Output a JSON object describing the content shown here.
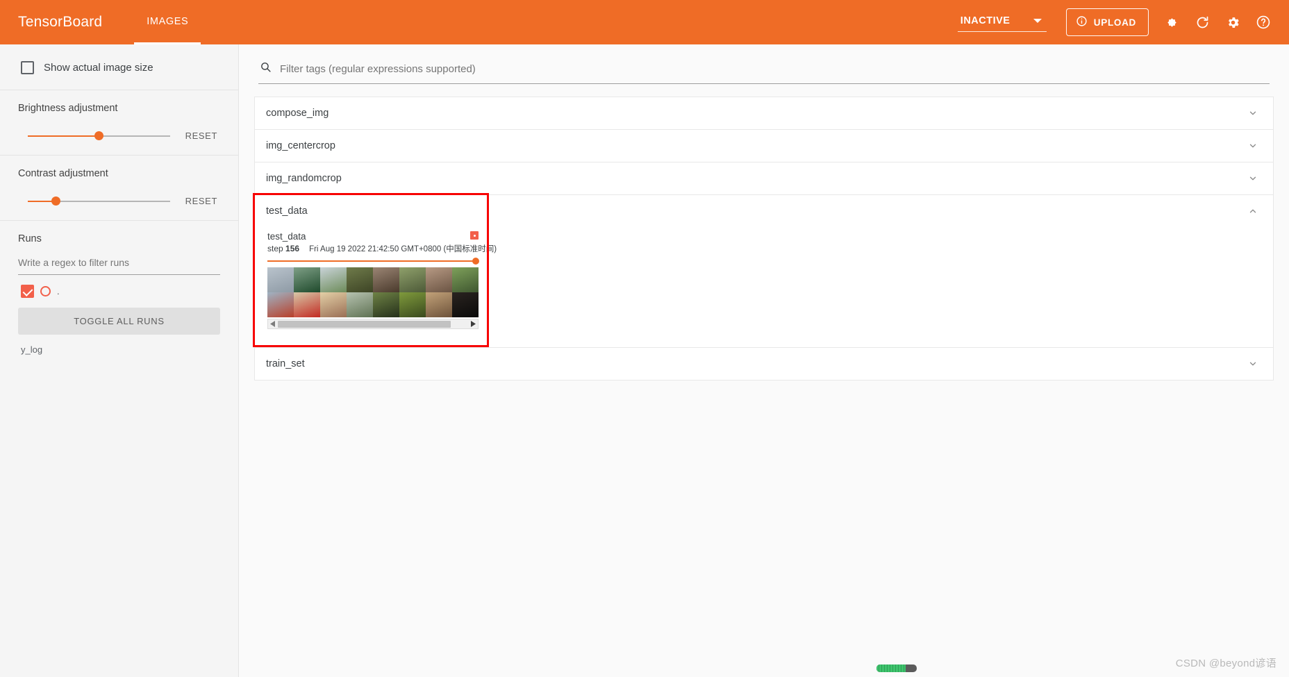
{
  "header": {
    "brand": "TensorBoard",
    "tabs": [
      {
        "label": "IMAGES",
        "active": true
      }
    ],
    "run_selector": {
      "value": "INACTIVE",
      "caret_icon": "caret-down-icon"
    },
    "upload_label": "UPLOAD",
    "upload_icon": "info-circle-icon",
    "icons": [
      {
        "name": "brightness-contrast-icon",
        "title": "Toggle dark mode"
      },
      {
        "name": "refresh-icon",
        "title": "Refresh"
      },
      {
        "name": "settings-gear-icon",
        "title": "Settings"
      },
      {
        "name": "help-circle-icon",
        "title": "Help"
      }
    ],
    "accent_color": "#ef6c26"
  },
  "sidebar": {
    "show_actual_size": {
      "label": "Show actual image size",
      "checked": false
    },
    "brightness": {
      "label": "Brightness adjustment",
      "reset_label": "RESET",
      "value_pct": 50
    },
    "contrast": {
      "label": "Contrast adjustment",
      "reset_label": "RESET",
      "value_pct": 20
    },
    "runs": {
      "heading": "Runs",
      "filter_placeholder": "Write a regex to filter runs",
      "filter_value": "",
      "items": [
        {
          "name": ".",
          "checked": true,
          "color": "#f2604a"
        }
      ],
      "toggle_all_label": "TOGGLE ALL RUNS",
      "footer_text": "y_log"
    }
  },
  "main": {
    "search": {
      "placeholder": "Filter tags (regular expressions supported)",
      "value": "",
      "icon": "search-icon"
    },
    "tags": [
      {
        "name": "compose_img",
        "expanded": false,
        "chevron": "chevron-down-icon"
      },
      {
        "name": "img_centercrop",
        "expanded": false,
        "chevron": "chevron-down-icon"
      },
      {
        "name": "img_randomcrop",
        "expanded": false,
        "chevron": "chevron-down-icon"
      },
      {
        "name": "test_data",
        "expanded": true,
        "chevron": "chevron-up-icon"
      },
      {
        "name": "train_set",
        "expanded": false,
        "chevron": "chevron-down-icon"
      }
    ],
    "image_card": {
      "title": "test_data",
      "step_label": "step",
      "step_value": "156",
      "timestamp": "Fri Aug 19 2022 21:42:50 GMT+0800 (中国标准时间)",
      "badge_icon": "run-color-swatch-icon",
      "slider_position_pct": 100,
      "grid": {
        "rows": 2,
        "cols": 8,
        "cells": [
          {
            "alt": "airplane",
            "c1": "#b9c3cc",
            "c2": "#8e9aa5"
          },
          {
            "alt": "automobile-green",
            "c1": "#7e9f86",
            "c2": "#1f4a2c"
          },
          {
            "alt": "airplane-runway",
            "c1": "#c9d3d8",
            "c2": "#6d8c5a"
          },
          {
            "alt": "bird-branch",
            "c1": "#6f7b4a",
            "c2": "#3d4425"
          },
          {
            "alt": "cat-ground",
            "c1": "#9b8574",
            "c2": "#4a3a2c"
          },
          {
            "alt": "deer-grass",
            "c1": "#8fa06b",
            "c2": "#4d5a38"
          },
          {
            "alt": "dog-person",
            "c1": "#b79a84",
            "c2": "#6b5443"
          },
          {
            "alt": "deer-forest",
            "c1": "#7ea05a",
            "c2": "#3f5730"
          },
          {
            "alt": "truck-road",
            "c1": "#9fb3c4",
            "c2": "#b8402a"
          },
          {
            "alt": "automobile-red",
            "c1": "#d8c8a8",
            "c2": "#c22a22"
          },
          {
            "alt": "bird-wood",
            "c1": "#e3cfa6",
            "c2": "#9a6f55"
          },
          {
            "alt": "automobile-white",
            "c1": "#b6c2b0",
            "c2": "#5f7253"
          },
          {
            "alt": "cat-dark",
            "c1": "#6e8245",
            "c2": "#25301a"
          },
          {
            "alt": "deer-field",
            "c1": "#7f9a3c",
            "c2": "#3a4a1e"
          },
          {
            "alt": "deer-brown",
            "c1": "#c2a279",
            "c2": "#6d523a"
          },
          {
            "alt": "dog-black",
            "c1": "#2a2420",
            "c2": "#0a0a0a"
          }
        ]
      },
      "scrollbar": {
        "left_arrow_icon": "arrow-left-icon",
        "right_arrow_icon": "arrow-right-icon",
        "thumb_width_pct": 91
      }
    }
  },
  "overlay": {
    "annotation_color": "#f70000",
    "watermark": "CSDN @beyond谚语"
  }
}
